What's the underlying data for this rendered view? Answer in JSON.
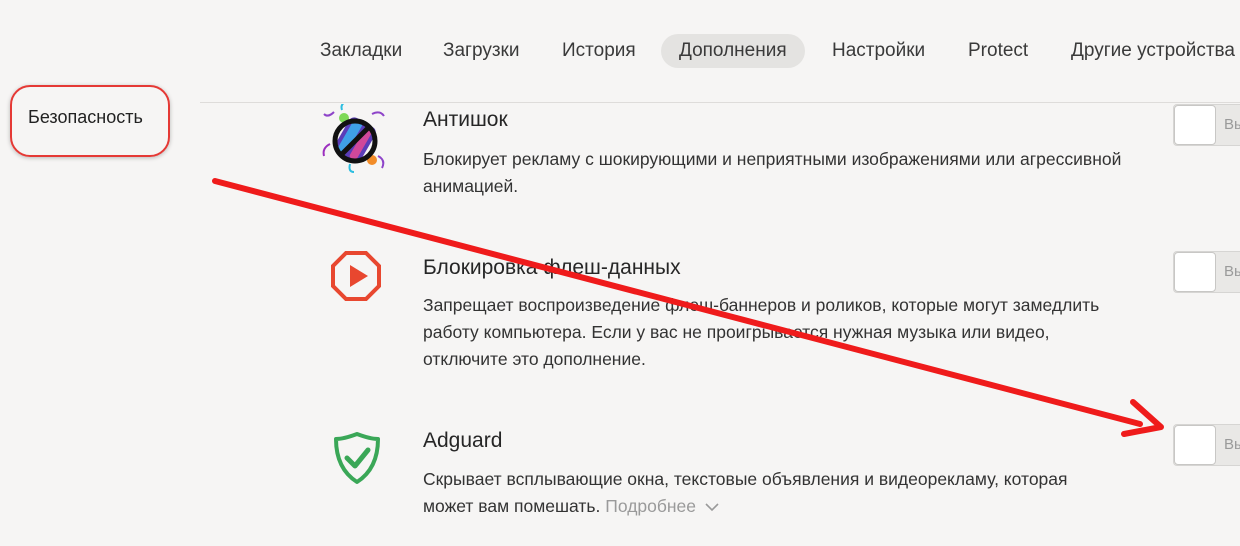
{
  "nav": {
    "items": [
      {
        "label": "Закладки"
      },
      {
        "label": "Загрузки"
      },
      {
        "label": "История"
      },
      {
        "label": "Дополнения",
        "active": true
      },
      {
        "label": "Настройки"
      },
      {
        "label": "Protect"
      },
      {
        "label": "Другие устройства"
      }
    ]
  },
  "sidebar": {
    "active_section": "Безопасность"
  },
  "extensions": [
    {
      "title": "Антишок",
      "description": "Блокирует рекламу с шокирующими и неприятными изображениями или агрессивной анимацией.",
      "icon": "antishock-icon",
      "toggle_label": "Вы"
    },
    {
      "title": "Блокировка флеш-данных",
      "description": "Запрещает воспроизведение флеш-баннеров и роликов, которые могут замедлить работу компьютера. Если у вас не проигрывается нужная музыка или видео, отключите это дополнение.",
      "icon": "flash-block-icon",
      "toggle_label": "Вы"
    },
    {
      "title": "Adguard",
      "description": "Скрывает всплывающие окна, текстовые объявления и видеорекламу, которая может вам помешать.",
      "more_label": "Подробнее",
      "icon": "adguard-shield-icon",
      "toggle_label": "Вы"
    }
  ],
  "colors": {
    "annotation_red": "#ef1b1b",
    "flash_icon_red": "#e8472f",
    "adguard_green": "#3aa757"
  }
}
